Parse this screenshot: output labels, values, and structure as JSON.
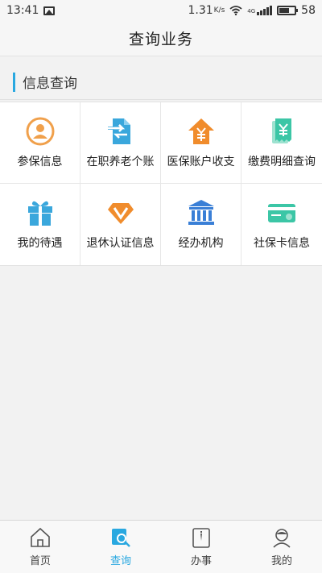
{
  "status_bar": {
    "time": "13:41",
    "speed": "1.31",
    "speed_unit": "K/s",
    "network": "4G",
    "battery": "58"
  },
  "header": {
    "title": "查询业务"
  },
  "section": {
    "title": "信息查询"
  },
  "grid": {
    "items": [
      {
        "label": "参保信息",
        "icon": "person-circle-icon",
        "color": "#f0a04b"
      },
      {
        "label": "在职养老个账",
        "icon": "transfer-document-icon",
        "color": "#3aa7dc"
      },
      {
        "label": "医保账户收支",
        "icon": "house-yen-icon",
        "color": "#f08c2c"
      },
      {
        "label": "缴费明细查询",
        "icon": "receipt-yen-icon",
        "color": "#3cc6a6"
      },
      {
        "label": "我的待遇",
        "icon": "gift-icon",
        "color": "#3aa7dc"
      },
      {
        "label": "退休认证信息",
        "icon": "diamond-v-icon",
        "color": "#f08c2c"
      },
      {
        "label": "经办机构",
        "icon": "bank-icon",
        "color": "#3a7fd6"
      },
      {
        "label": "社保卡信息",
        "icon": "card-icon",
        "color": "#3cc6a6"
      }
    ]
  },
  "bottom_nav": {
    "items": [
      {
        "label": "首页",
        "icon": "home-icon",
        "active": false
      },
      {
        "label": "查询",
        "icon": "search-icon",
        "active": true
      },
      {
        "label": "办事",
        "icon": "clipboard-icon",
        "active": false
      },
      {
        "label": "我的",
        "icon": "user-icon",
        "active": false
      }
    ]
  },
  "colors": {
    "accent": "#29a8e0",
    "background": "#f2f2f2"
  }
}
